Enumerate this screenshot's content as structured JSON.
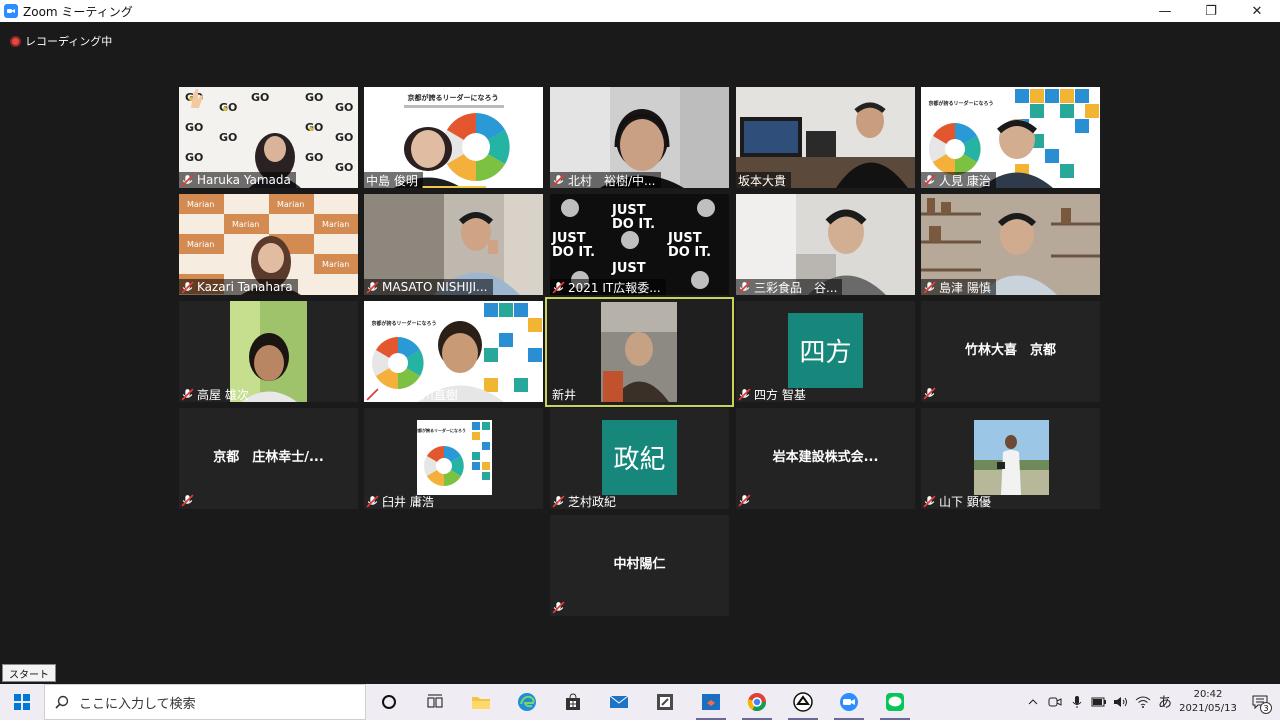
{
  "window": {
    "title": "Zoom ミーティング",
    "minimize_glyph": "—",
    "restore_glyph": "❐",
    "close_glyph": "✕"
  },
  "recording": {
    "label": "レコーディング中"
  },
  "participants": [
    {
      "name": "Haruka Yamada",
      "video": true
    },
    {
      "name": "中島 俊明",
      "video": true
    },
    {
      "name": "北村　裕樹/中...",
      "video": true
    },
    {
      "name": "坂本大貴",
      "video": true
    },
    {
      "name": "人見 康治",
      "video": true
    },
    {
      "name": "Kazari Tanahara",
      "video": true
    },
    {
      "name": "MASATO NISHIJI...",
      "video": true
    },
    {
      "name": "2021 IT広報委...",
      "video": true
    },
    {
      "name": "三彩食品　谷...",
      "video": true
    },
    {
      "name": "島津 陽慎",
      "video": true
    },
    {
      "name": "高屋 雄次",
      "video": true
    },
    {
      "name": "京都 西川直樹",
      "video": true
    },
    {
      "name": "新井",
      "video": true,
      "active_speaker": true
    },
    {
      "name": "四方 智基",
      "avatar_text": "四方",
      "avatar_color": "#16877a"
    },
    {
      "name": "竹林大喜　京都",
      "name_only": true
    },
    {
      "name": "京都　庄林幸士/...",
      "name_only": true
    },
    {
      "name": "臼井 庸浩",
      "video": true
    },
    {
      "name": "芝村政紀",
      "avatar_text": "政紀",
      "avatar_color": "#16877a"
    },
    {
      "name": "岩本建設株式会...",
      "name_only": true
    },
    {
      "name": "山下 顕優",
      "video": true
    },
    {
      "name": "中村陽仁",
      "name_only": true
    }
  ],
  "posters": {
    "title": "京都が誇るリーダーになろう"
  },
  "logos": {
    "go": "GO",
    "marian": "Marian",
    "just": "JUST",
    "doit": "DO IT."
  },
  "taskbar": {
    "start_tooltip": "スタート",
    "search_placeholder": "ここに入力して検索",
    "ime": "あ",
    "time": "20:42",
    "date": "2021/05/13",
    "notifications": "3"
  }
}
